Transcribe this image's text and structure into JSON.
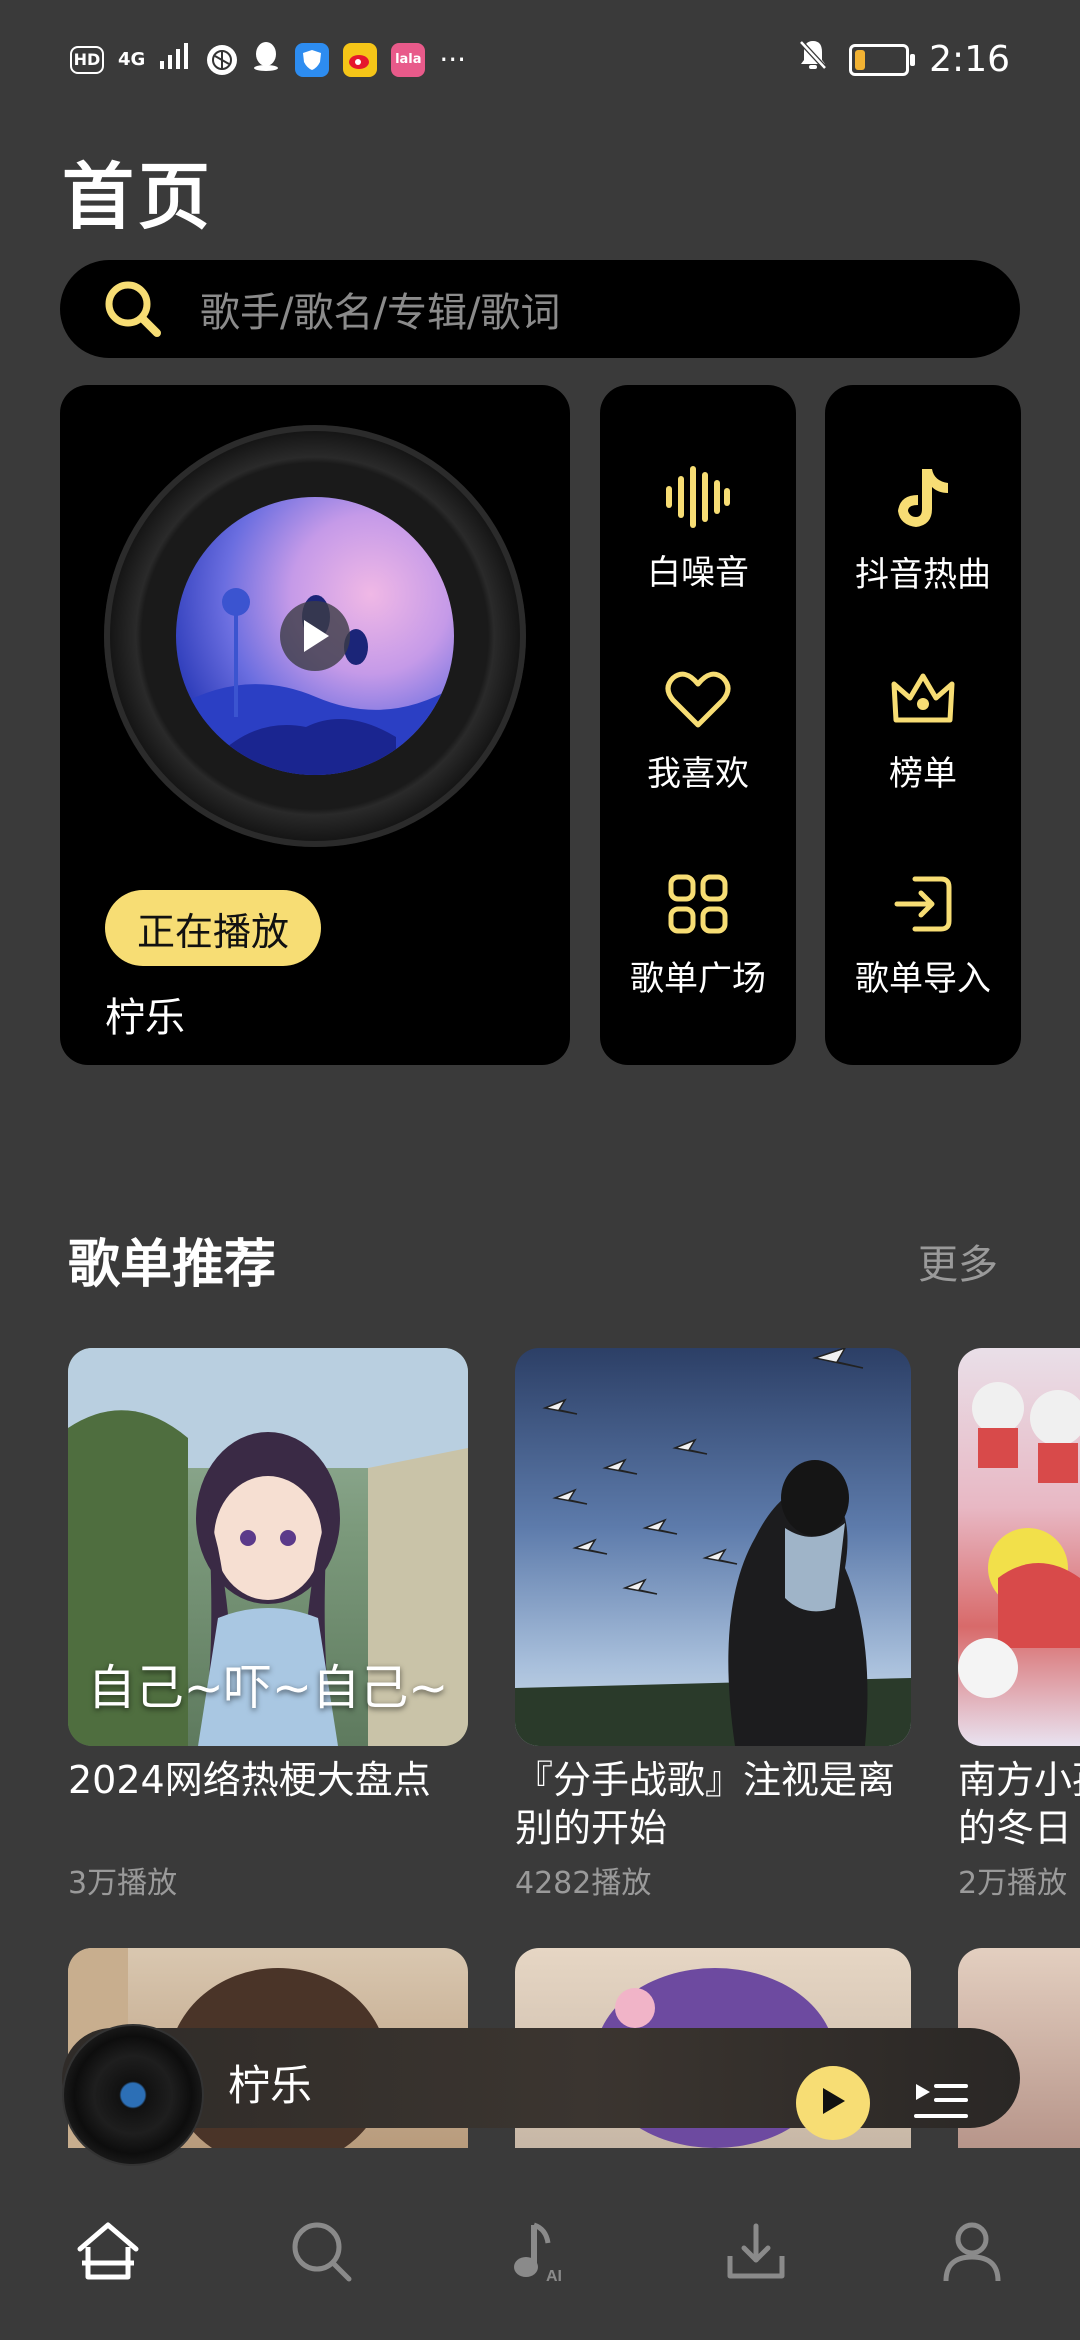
{
  "status_bar": {
    "hd": "HD",
    "network": "4G",
    "more": "···",
    "time": "2:16",
    "battery_level": 0.2
  },
  "page_title": "首页",
  "search": {
    "placeholder": "歌手/歌名/专辑/歌词"
  },
  "now_playing_card": {
    "badge": "正在播放",
    "name": "柠乐"
  },
  "shortcuts": [
    {
      "label": "白噪音",
      "icon": "soundwave-icon"
    },
    {
      "label": "我喜欢",
      "icon": "heart-icon"
    },
    {
      "label": "歌单广场",
      "icon": "grid-icon"
    },
    {
      "label": "抖音热曲",
      "icon": "tiktok-icon"
    },
    {
      "label": "榜单",
      "icon": "crown-icon"
    },
    {
      "label": "歌单导入",
      "icon": "import-icon"
    }
  ],
  "section": {
    "title": "歌单推荐",
    "more": "更多"
  },
  "playlists": [
    {
      "title": "2024网络热梗大盘点",
      "plays": "3万播放",
      "overlay": "自己~吓~自己~"
    },
    {
      "title": "『分手战歌』注视是离别的开始",
      "plays": "4282播放",
      "overlay": ""
    },
    {
      "title": "南方小孩的冬日",
      "plays": "2万播放",
      "overlay": ""
    }
  ],
  "mini_player": {
    "name": "柠乐"
  },
  "bottom_nav": [
    {
      "name": "home",
      "icon": "home-icon",
      "active": true
    },
    {
      "name": "search",
      "icon": "search-icon",
      "active": false
    },
    {
      "name": "ai-music",
      "icon": "ai-music-icon",
      "active": false
    },
    {
      "name": "download",
      "icon": "download-icon",
      "active": false
    },
    {
      "name": "profile",
      "icon": "user-icon",
      "active": false
    }
  ],
  "colors": {
    "accent": "#f7dd74",
    "background": "#3a3a3a",
    "card": "#000000"
  }
}
